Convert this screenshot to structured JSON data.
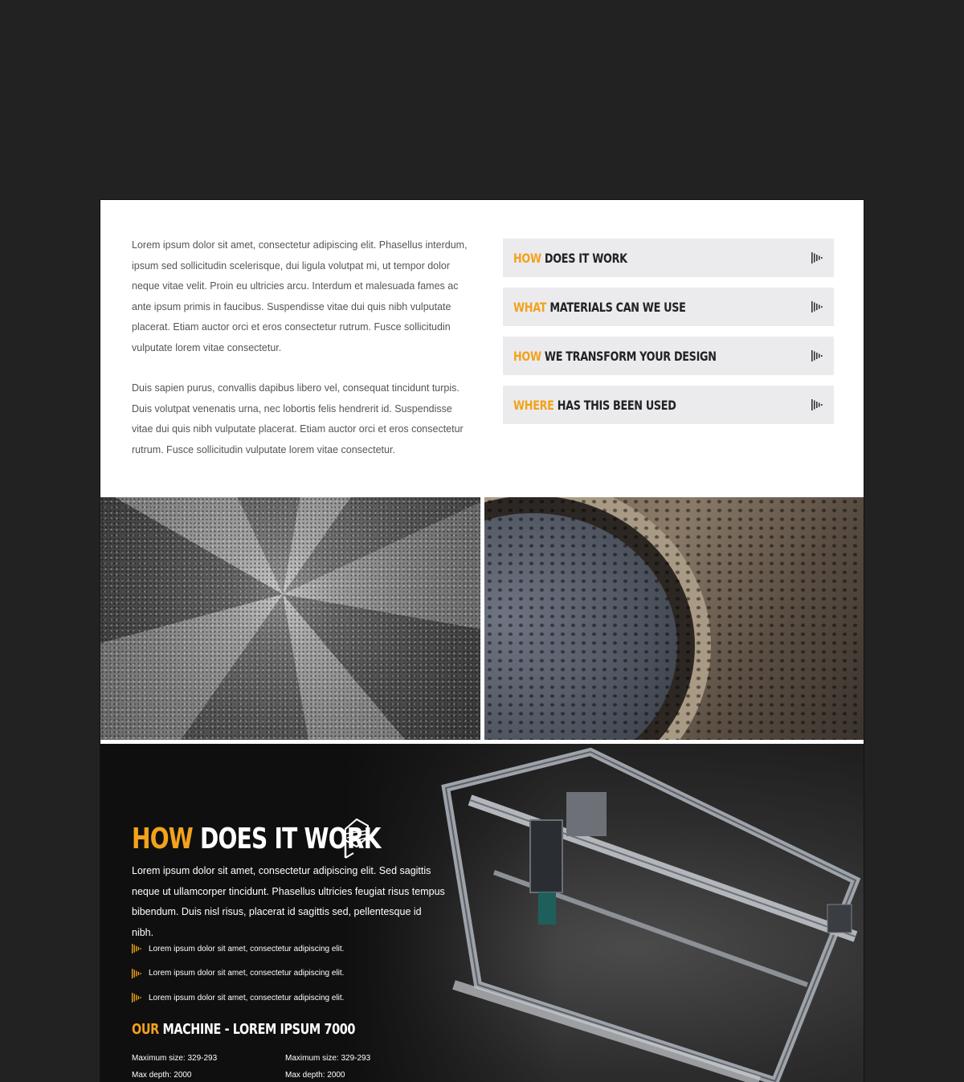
{
  "intro": {
    "paragraphs": [
      "Lorem ipsum dolor sit amet, consectetur adipiscing elit. Phasellus interdum, ipsum sed sollicitudin scelerisque, dui ligula volutpat mi, ut tempor dolor neque vitae velit. Proin eu ultricies arcu. Interdum et malesuada fames ac ante ipsum primis in faucibus. Suspendisse vitae dui quis nibh vulputate placerat. Etiam auctor orci et eros consectetur rutrum. Fusce sollicitudin vulputate lorem vitae consectetur.",
      "Duis sapien purus, convallis dapibus libero vel, consequat tincidunt turpis. Duis volutpat venenatis urna, nec lobortis felis hendrerit id. Suspendisse vitae dui quis nibh vulputate placerat. Etiam auctor orci et eros consectetur rutrum. Fusce sollicitudin vulputate lorem vitae consectetur."
    ]
  },
  "accordion": [
    {
      "highlight": "HOW",
      "rest": " DOES IT WORK",
      "icon": "arrow-stripes-icon"
    },
    {
      "highlight": "WHAT",
      "rest": " MATERIALS CAN WE USE",
      "icon": "arrow-stripes-icon"
    },
    {
      "highlight": "HOW",
      "rest": " WE TRANSFORM YOUR DESIGN",
      "icon": "arrow-stripes-icon"
    },
    {
      "highlight": "WHERE",
      "rest": " HAS THIS BEEN USED",
      "icon": "arrow-stripes-icon"
    }
  ],
  "dark_section": {
    "title_highlight": "HOW",
    "title_rest": " DOES IT WORK",
    "description": "Lorem ipsum dolor sit amet, consectetur adipiscing elit. Sed sagittis neque ut ullamcorper tincidunt. Phasellus ultricies feugiat risus tempus bibendum. Duis nisl risus, placerat id sagittis sed, pellentesque id nibh.",
    "bullets": [
      "Lorem ipsum dolor sit amet, consectetur adipiscing elit.",
      "Lorem ipsum dolor sit amet, consectetur adipiscing elit.",
      "Lorem ipsum dolor sit amet, consectetur adipiscing elit."
    ],
    "machine_highlight": "OUR",
    "machine_rest": " MACHINE - LOREM IPSUM 7000",
    "specs": [
      [
        "Maximum size: 329-293",
        "Max  depth: 2000"
      ],
      [
        "Maximum size: 329-293",
        "Max  depth: 2000"
      ]
    ]
  },
  "colors": {
    "accent": "#f2a21b",
    "background": "#222222",
    "accordion_bg": "#ebebee"
  }
}
